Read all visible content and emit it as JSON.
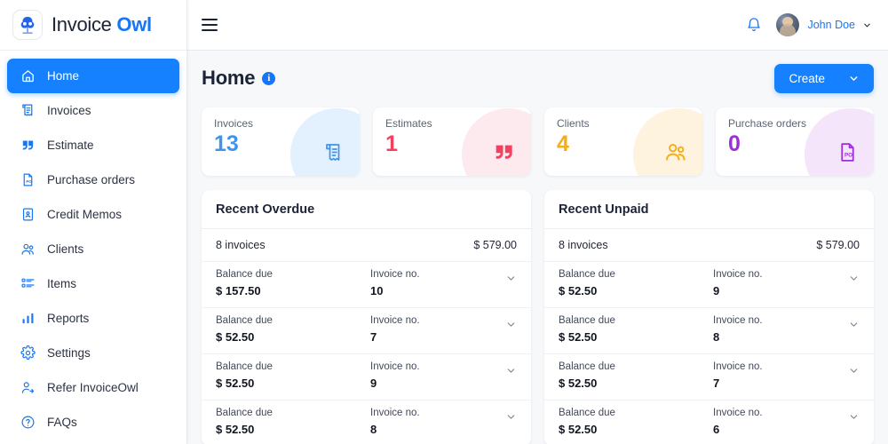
{
  "brand": {
    "name_plain": "Invoice ",
    "name_bold": "Owl",
    "logo_icon": "owl-logo-icon"
  },
  "colors": {
    "accent": "#1681ff",
    "invoices": "#3d95f0",
    "estimates": "#f43f5e",
    "clients": "#f5ae1a",
    "purchase_orders": "#9b30d9",
    "sidebar_active": "#1681ff"
  },
  "sidebar": {
    "items": [
      {
        "label": "Home",
        "icon": "home-icon",
        "active": true
      },
      {
        "label": "Invoices",
        "icon": "invoice-icon",
        "active": false
      },
      {
        "label": "Estimate",
        "icon": "estimate-icon",
        "active": false
      },
      {
        "label": "Purchase orders",
        "icon": "purchase-order-icon",
        "active": false
      },
      {
        "label": "Credit Memos",
        "icon": "credit-memo-icon",
        "active": false
      },
      {
        "label": "Clients",
        "icon": "clients-icon",
        "active": false
      },
      {
        "label": "Items",
        "icon": "items-icon",
        "active": false
      },
      {
        "label": "Reports",
        "icon": "reports-icon",
        "active": false
      },
      {
        "label": "Settings",
        "icon": "gear-icon",
        "active": false
      },
      {
        "label": "Refer InvoiceOwl",
        "icon": "refer-user-icon",
        "active": false
      },
      {
        "label": "FAQs",
        "icon": "question-circle-icon",
        "active": false
      }
    ]
  },
  "topbar": {
    "menu_icon": "hamburger-icon",
    "notification_icon": "bell-icon",
    "user_name": "John Doe",
    "user_caret_icon": "chevron-down-icon",
    "avatar_icon": "avatar"
  },
  "page": {
    "title": "Home",
    "info_icon": "info-icon",
    "info_glyph": "i",
    "create_label": "Create",
    "create_caret_icon": "chevron-down-icon"
  },
  "stats": [
    {
      "label": "Invoices",
      "value": "13",
      "icon": "invoice-icon",
      "color": "#3d95f0",
      "blob": "#e3f0fe"
    },
    {
      "label": "Estimates",
      "value": "1",
      "icon": "estimate-icon",
      "color": "#f43f5e",
      "blob": "#fdeaee"
    },
    {
      "label": "Clients",
      "value": "4",
      "icon": "clients-icon",
      "color": "#f5ae1a",
      "blob": "#fdf3df"
    },
    {
      "label": "Purchase orders",
      "value": "0",
      "icon": "purchase-order-icon",
      "color": "#9b30d9",
      "blob": "#f4e5fb"
    }
  ],
  "panels": [
    {
      "title": "Recent Overdue",
      "count_label": "8 invoices",
      "total": "$ 579.00",
      "balance_label": "Balance due",
      "invoice_label": "Invoice no.",
      "chevron_icon": "chevron-down-icon",
      "rows": [
        {
          "balance": "$ 157.50",
          "invoice_no": "10"
        },
        {
          "balance": "$ 52.50",
          "invoice_no": "7"
        },
        {
          "balance": "$ 52.50",
          "invoice_no": "9"
        },
        {
          "balance": "$ 52.50",
          "invoice_no": "8"
        }
      ]
    },
    {
      "title": "Recent Unpaid",
      "count_label": "8 invoices",
      "total": "$ 579.00",
      "balance_label": "Balance due",
      "invoice_label": "Invoice no.",
      "chevron_icon": "chevron-down-icon",
      "rows": [
        {
          "balance": "$ 52.50",
          "invoice_no": "9"
        },
        {
          "balance": "$ 52.50",
          "invoice_no": "8"
        },
        {
          "balance": "$ 52.50",
          "invoice_no": "7"
        },
        {
          "balance": "$ 52.50",
          "invoice_no": "6"
        }
      ]
    }
  ]
}
